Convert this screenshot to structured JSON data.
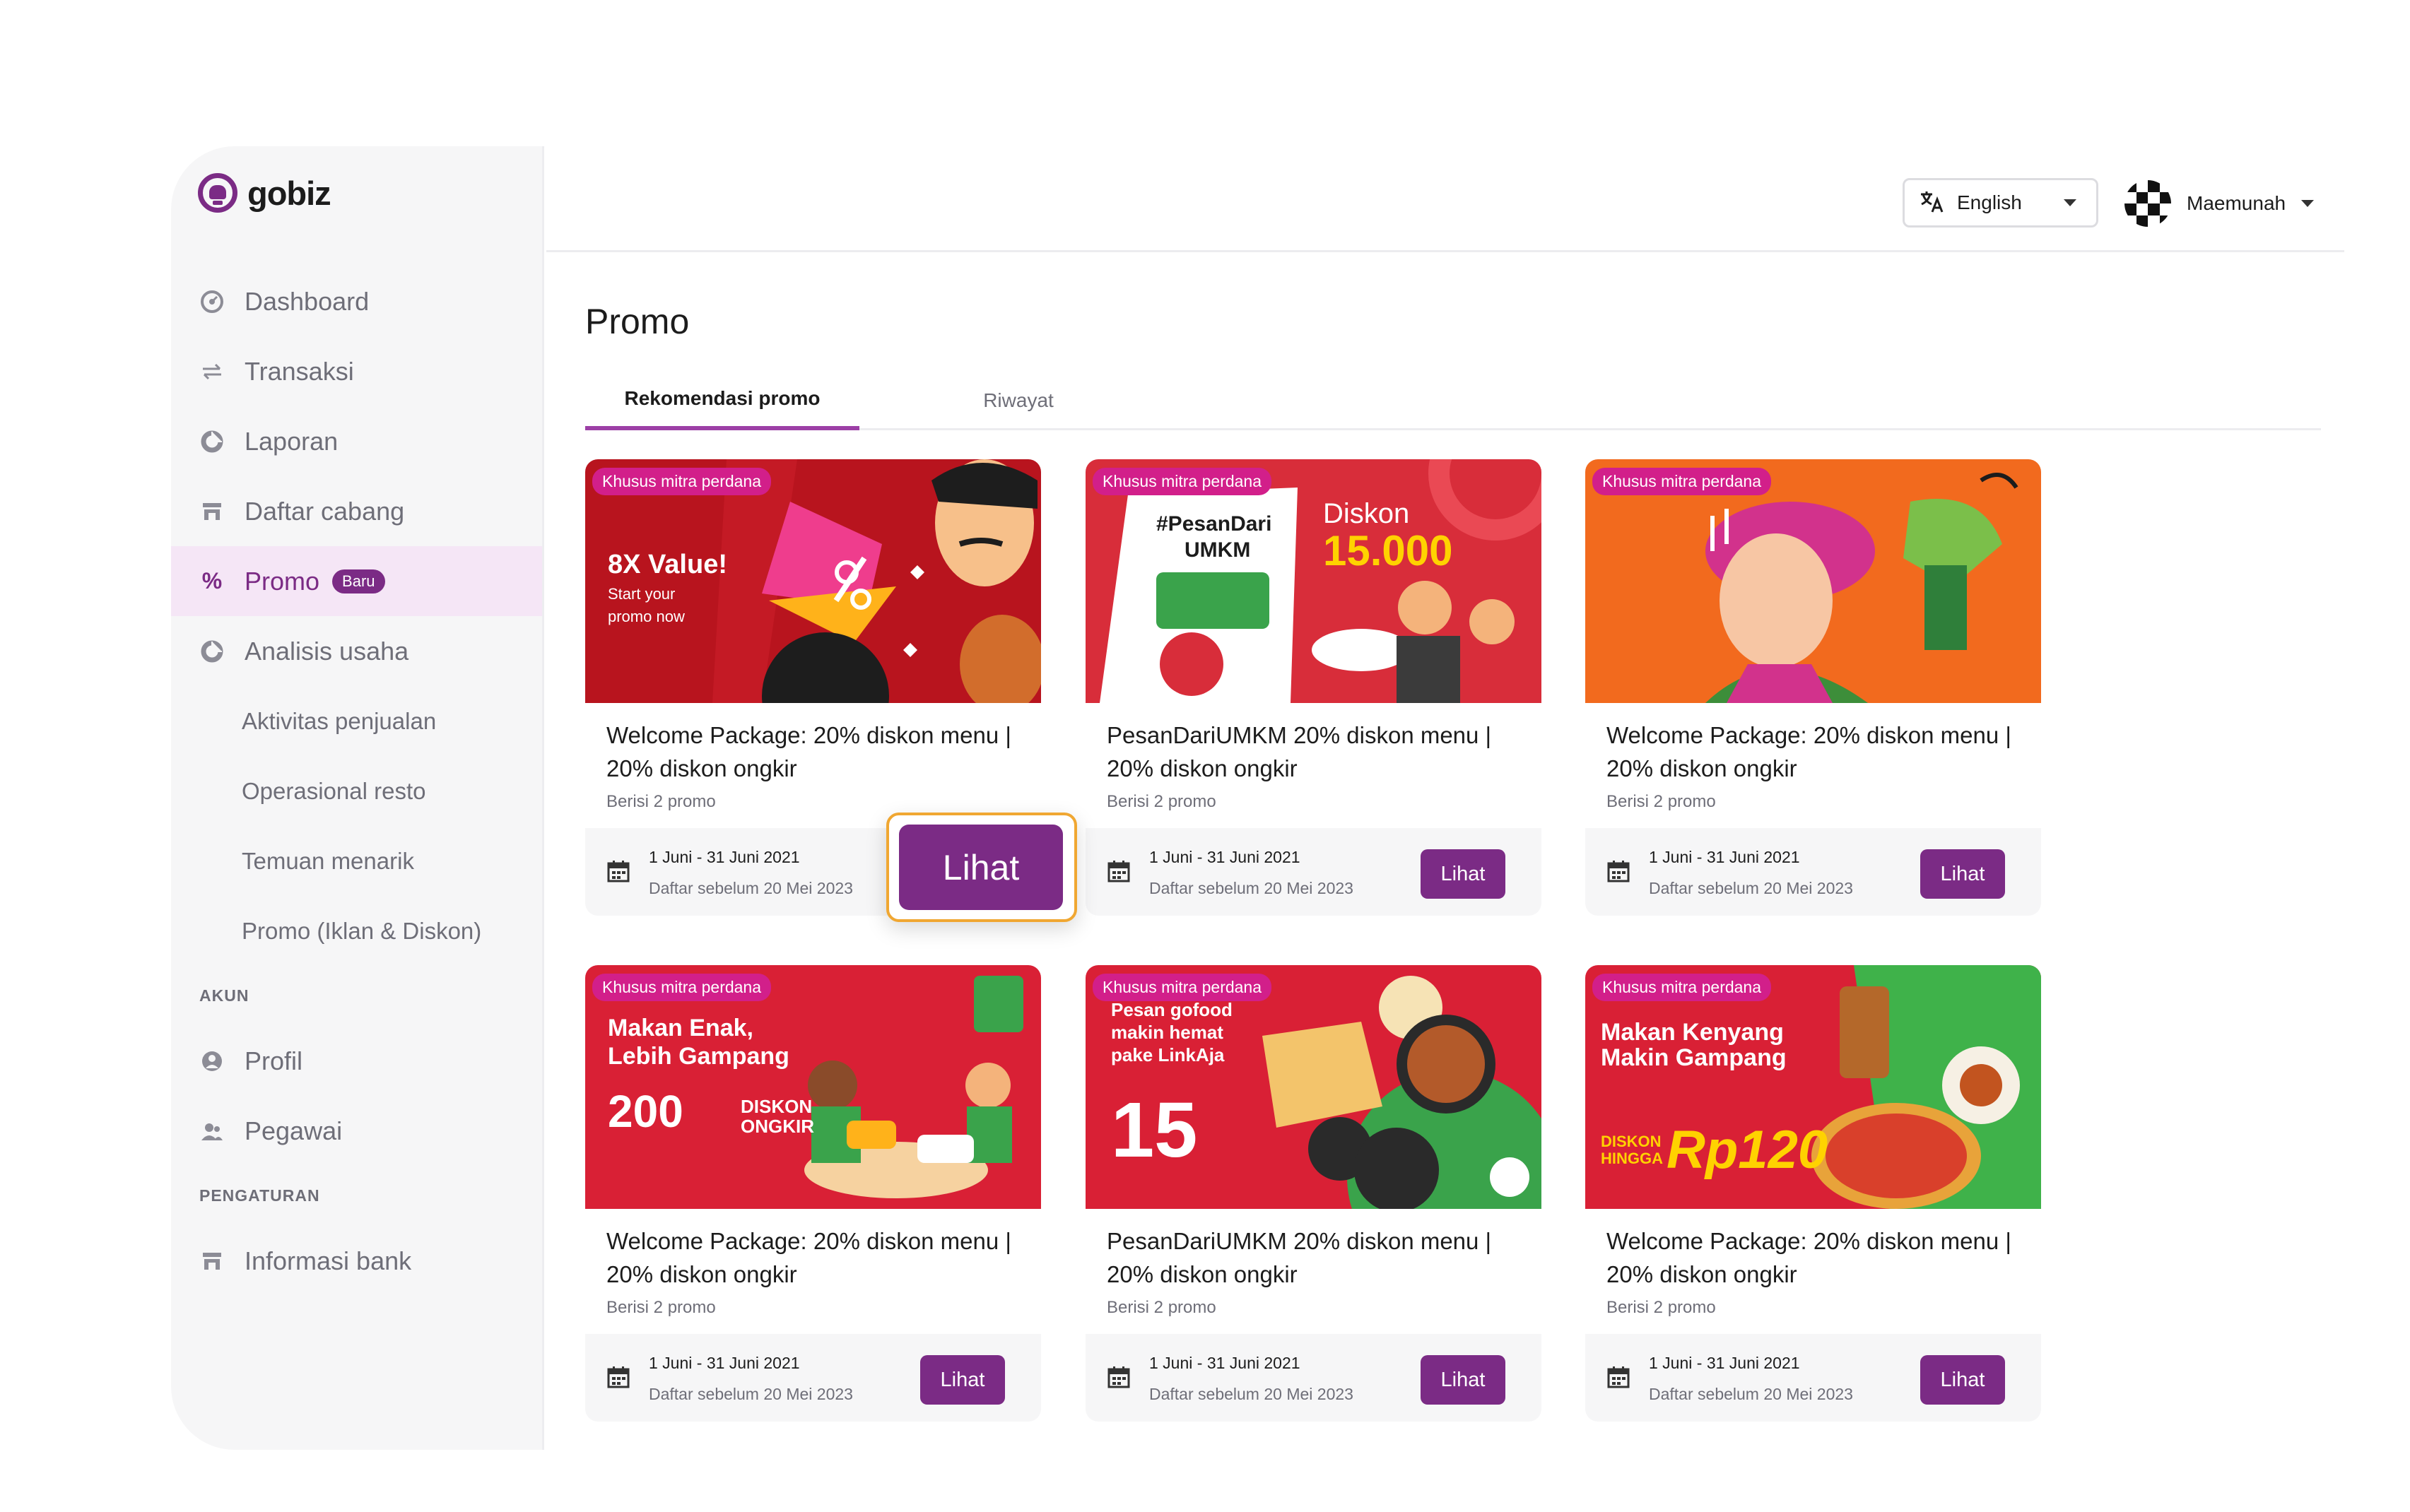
{
  "brand": {
    "name": "gobiz"
  },
  "header": {
    "language": "English",
    "user_name": "Maemunah"
  },
  "sidebar": {
    "items": [
      {
        "label": "Dashboard"
      },
      {
        "label": "Transaksi"
      },
      {
        "label": "Laporan"
      },
      {
        "label": "Daftar cabang"
      },
      {
        "label": "Promo",
        "badge": "Baru"
      },
      {
        "label": "Analisis usaha"
      },
      {
        "label": "Aktivitas penjualan"
      },
      {
        "label": "Operasional resto"
      },
      {
        "label": "Temuan menarik"
      },
      {
        "label": "Promo (Iklan & Diskon)"
      }
    ],
    "section_akun": "AKUN",
    "akun_items": [
      {
        "label": "Profil"
      },
      {
        "label": "Pegawai"
      }
    ],
    "section_pengaturan": "PENGATURAN",
    "pengaturan_items": [
      {
        "label": "Informasi bank"
      }
    ]
  },
  "main": {
    "title": "Promo",
    "tabs": [
      {
        "label": "Rekomendasi promo"
      },
      {
        "label": "Riwayat"
      }
    ],
    "cards": [
      {
        "tag": "Khusus mitra perdana",
        "title": "Welcome Package: 20% diskon menu | 20% diskon ongkir",
        "subtitle": "Berisi 2 promo",
        "dates": "1 Juni - 31 Juni 2021",
        "deadline": "Daftar sebelum 20 Mei 2023",
        "button": "Lihat",
        "banner_lines": [
          "8X Value!",
          "Start your",
          "promo now"
        ]
      },
      {
        "tag": "Khusus mitra perdana",
        "title": "PesanDariUMKM 20% diskon menu | 20% diskon ongkir",
        "subtitle": "Berisi 2 promo",
        "dates": "1 Juni - 31 Juni 2021",
        "deadline": "Daftar sebelum 20 Mei 2023",
        "button": "Lihat",
        "banner_lines": [
          "#PesanDari",
          "UMKM",
          "Diskon",
          "15.000"
        ]
      },
      {
        "tag": "Khusus mitra perdana",
        "title": "Welcome Package: 20% diskon menu | 20% diskon ongkir",
        "subtitle": "Berisi 2 promo",
        "dates": "1 Juni - 31 Juni 2021",
        "deadline": "Daftar sebelum 20 Mei 2023",
        "button": "Lihat",
        "banner_lines": []
      },
      {
        "tag": "Khusus mitra perdana",
        "title": "Welcome Package: 20% diskon menu | 20% diskon ongkir",
        "subtitle": "Berisi 2 promo",
        "dates": "1 Juni - 31 Juni 2021",
        "deadline": "Daftar sebelum 20 Mei 2023",
        "button": "Lihat",
        "banner_lines": [
          "Makan Enak,",
          "Lebih Gampang",
          "200",
          "DISKON ONGKIR"
        ]
      },
      {
        "tag": "Khusus mitra perdana",
        "title": "PesanDariUMKM 20% diskon menu | 20% diskon ongkir",
        "subtitle": "Berisi 2 promo",
        "dates": "1 Juni - 31 Juni 2021",
        "deadline": "Daftar sebelum 20 Mei 2023",
        "button": "Lihat",
        "banner_lines": [
          "Pesan gofood",
          "makin hemat",
          "pake LinkAja",
          "15"
        ]
      },
      {
        "tag": "Khusus mitra perdana",
        "title": "Welcome Package: 20% diskon menu | 20% diskon ongkir",
        "subtitle": "Berisi 2 promo",
        "dates": "1 Juni - 31 Juni 2021",
        "deadline": "Daftar sebelum 20 Mei 2023",
        "button": "Lihat",
        "banner_lines": [
          "Makan Kenyang",
          "Makin Gampang",
          "DISKON HINGGA",
          "Rp120"
        ]
      }
    ],
    "highlight_button": "Lihat"
  },
  "colors": {
    "brand": "#7b2b85",
    "highlight": "#f0a732",
    "tag": "#d21f8a"
  }
}
